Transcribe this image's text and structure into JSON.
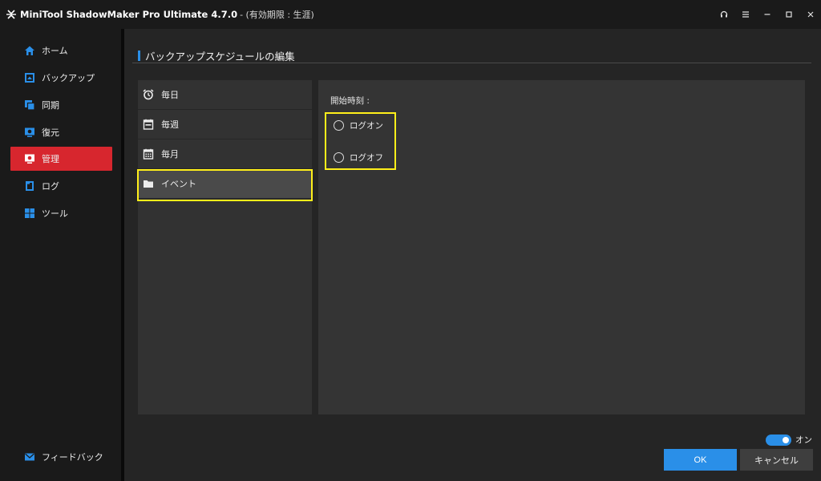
{
  "window": {
    "title": "MiniTool ShadowMaker Pro Ultimate 4.7.0",
    "subtitle": "- (有効期限 : 生涯)",
    "controls": [
      "headset-icon",
      "menu-icon",
      "minimize-icon",
      "maximize-icon",
      "close-icon"
    ]
  },
  "sidebar": {
    "items": [
      {
        "label": "ホーム",
        "icon": "home-icon"
      },
      {
        "label": "バックアップ",
        "icon": "backup-icon"
      },
      {
        "label": "同期",
        "icon": "sync-icon"
      },
      {
        "label": "復元",
        "icon": "restore-icon"
      },
      {
        "label": "管理",
        "icon": "manage-icon",
        "active": true
      },
      {
        "label": "ログ",
        "icon": "log-icon"
      },
      {
        "label": "ツール",
        "icon": "tools-icon"
      }
    ],
    "feedback": {
      "label": "フィードバック",
      "icon": "mail-icon"
    }
  },
  "main": {
    "title": "バックアップスケジュールの編集",
    "schedule_types": [
      {
        "label": "毎日",
        "icon": "alarm-clock-icon"
      },
      {
        "label": "毎週",
        "icon": "calendar-week-icon"
      },
      {
        "label": "毎月",
        "icon": "calendar-month-icon"
      },
      {
        "label": "イベント",
        "icon": "folder-icon",
        "selected": true
      }
    ],
    "start_label": "開始時刻 :",
    "options": [
      {
        "label": "ログオン",
        "checked": false
      },
      {
        "label": "ログオフ",
        "checked": false
      }
    ]
  },
  "footer": {
    "toggle_label": "オン",
    "toggle_on": true,
    "ok_label": "OK",
    "cancel_label": "キャンセル"
  },
  "colors": {
    "accent": "#2a8fe8",
    "active_nav": "#d7262e",
    "highlight": "#ffef1a"
  }
}
